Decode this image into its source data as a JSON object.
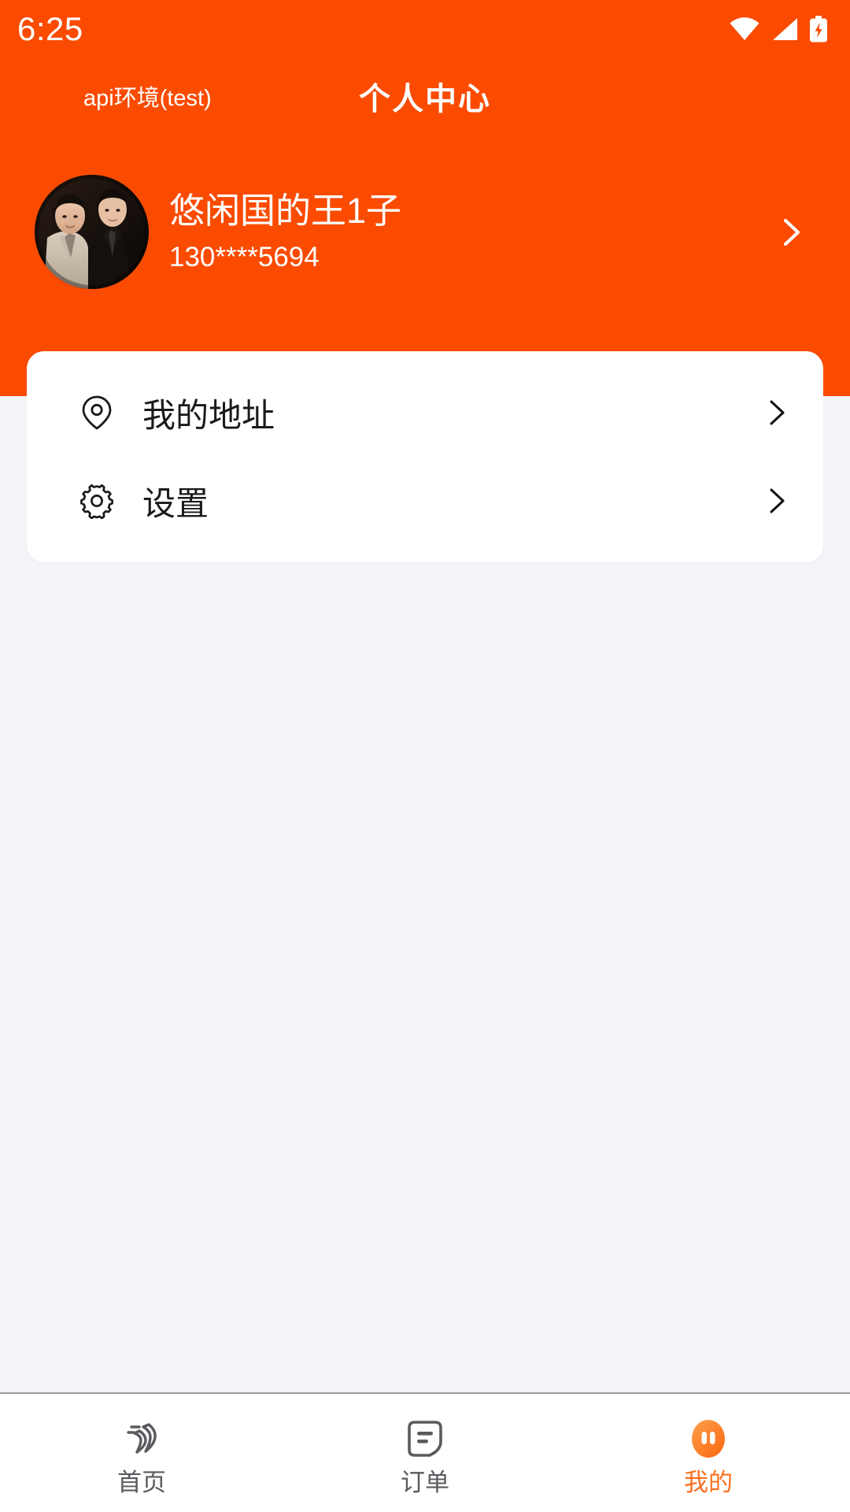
{
  "theme": {
    "header_bg": "#FA4B00",
    "page_bg": "#F4F4F8",
    "card_bg": "#FFFFFF",
    "accent": "#FA7022",
    "text_primary": "#1A1A1A",
    "text_muted": "#5A5A5F",
    "text_on_header": "#FFFFFF"
  },
  "status_bar": {
    "time": "6:25",
    "icons": [
      {
        "name": "wifi-icon",
        "label": "wifi"
      },
      {
        "name": "signal-icon",
        "label": "cellular-signal"
      },
      {
        "name": "battery-charging-icon",
        "label": "battery-charging"
      }
    ]
  },
  "header": {
    "env_label": "api环境(test)",
    "title": "个人中心"
  },
  "profile": {
    "name": "悠闲国的王1子",
    "phone": "130****5694",
    "avatar_name": "user-avatar-photo",
    "chevron_name": "chevron-right-icon"
  },
  "menu": {
    "items": [
      {
        "icon": "location-pin-icon",
        "label": "我的地址"
      },
      {
        "icon": "gear-icon",
        "label": "设置"
      }
    ]
  },
  "bottom_nav": {
    "items": [
      {
        "key": "home",
        "icon": "home-speed-icon",
        "label": "首页",
        "active": false
      },
      {
        "key": "orders",
        "icon": "document-icon",
        "label": "订单",
        "active": false
      },
      {
        "key": "mine",
        "icon": "profile-face-icon",
        "label": "我的",
        "active": true
      }
    ]
  }
}
